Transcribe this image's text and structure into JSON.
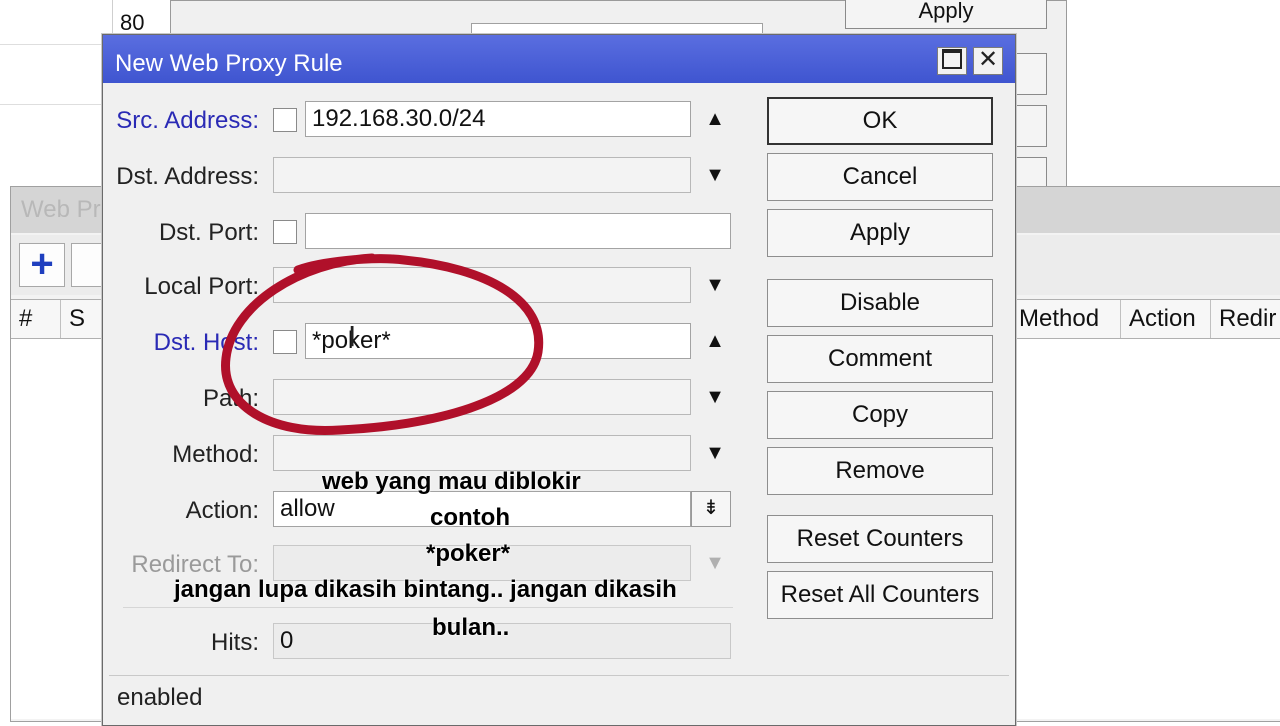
{
  "background": {
    "list_number": "80",
    "top_window": {
      "apply_label": "Apply"
    },
    "proxy_window": {
      "title": "Web Pr",
      "columns": [
        "#",
        "S",
        "Method",
        "Action",
        "Redir"
      ]
    }
  },
  "dialog": {
    "title": "New Web Proxy Rule",
    "fields": {
      "src_address": {
        "label": "Src. Address:",
        "value": "192.168.30.0/24"
      },
      "dst_address": {
        "label": "Dst. Address:",
        "value": ""
      },
      "dst_port": {
        "label": "Dst. Port:",
        "value": ""
      },
      "local_port": {
        "label": "Local Port:",
        "value": ""
      },
      "dst_host": {
        "label": "Dst. Host:",
        "value": "*poker*"
      },
      "path": {
        "label": "Path:",
        "value": ""
      },
      "method": {
        "label": "Method:",
        "value": ""
      },
      "action": {
        "label": "Action:",
        "value": "allow"
      },
      "redirect_to": {
        "label": "Redirect To:",
        "value": ""
      },
      "hits": {
        "label": "Hits:",
        "value": "0"
      }
    },
    "buttons": {
      "ok": "OK",
      "cancel": "Cancel",
      "apply": "Apply",
      "disable": "Disable",
      "comment": "Comment",
      "copy": "Copy",
      "remove": "Remove",
      "reset_counters": "Reset Counters",
      "reset_all_counters": "Reset All Counters"
    },
    "status": "enabled"
  },
  "annotation": {
    "line1": "web yang mau diblokir",
    "line2": "contoh",
    "line3": "*poker*",
    "line4": "jangan lupa dikasih bintang.. jangan dikasih",
    "line5": "bulan..",
    "circle_color": "#b0102a"
  }
}
